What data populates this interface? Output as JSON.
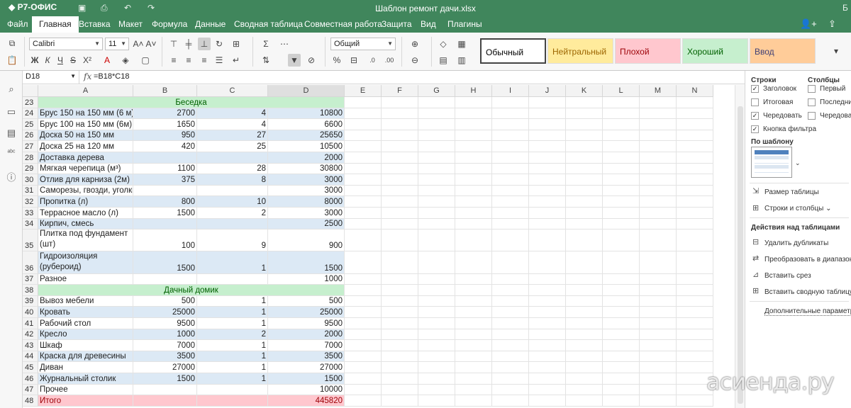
{
  "app": {
    "logo": "Р7-ОФИС",
    "doc_title": "Шаблон ремонт дачи.xlsx",
    "corner_text": "Б"
  },
  "tabs": [
    "Файл",
    "Главная",
    "Вставка",
    "Макет",
    "Формула",
    "Данные",
    "Сводная таблица",
    "Совместная работа",
    "Защита",
    "Вид",
    "Плагины"
  ],
  "toolbar": {
    "font_name": "Calibri",
    "font_size": "11",
    "number_format": "Общий",
    "styles": [
      {
        "label": "Обычный",
        "bg": "#ffffff",
        "color": "#000000"
      },
      {
        "label": "Нейтральный",
        "bg": "#ffeb9c",
        "color": "#9c6500"
      },
      {
        "label": "Плохой",
        "bg": "#ffc7ce",
        "color": "#9c0006"
      },
      {
        "label": "Хороший",
        "bg": "#c6efce",
        "color": "#006100"
      },
      {
        "label": "Ввод",
        "bg": "#ffcc99",
        "color": "#3f3f76"
      }
    ]
  },
  "formula_bar": {
    "cell_ref": "D18",
    "fx": "fx",
    "formula": "=B18*C18"
  },
  "columns": [
    "A",
    "B",
    "C",
    "D",
    "E",
    "F",
    "G",
    "H",
    "I",
    "J",
    "K",
    "L",
    "M",
    "N"
  ],
  "rows": [
    {
      "n": "23",
      "type": "section",
      "a": "Беседка"
    },
    {
      "n": "24",
      "a": "Брус 150 на 150 мм (6 м)",
      "b": "2700",
      "c": "4",
      "d": "10800"
    },
    {
      "n": "25",
      "a": "Брус 100 на 150 мм (6м)",
      "b": "1650",
      "c": "4",
      "d": "6600"
    },
    {
      "n": "26",
      "a": "Доска 50 на 150 мм",
      "b": "950",
      "c": "27",
      "d": "25650"
    },
    {
      "n": "27",
      "a": "Доска 25 на 120 мм",
      "b": "420",
      "c": "25",
      "d": "10500"
    },
    {
      "n": "28",
      "a": "Доставка дерева",
      "b": "",
      "c": "",
      "d": "2000"
    },
    {
      "n": "29",
      "a": "Мягкая черепица (м³)",
      "b": "1100",
      "c": "28",
      "d": "30800"
    },
    {
      "n": "30",
      "a": "Отлив для карниза (2м)",
      "b": "375",
      "c": "8",
      "d": "3000"
    },
    {
      "n": "31",
      "a": "Саморезы, гвозди, уголки",
      "b": "",
      "c": "",
      "d": "3000"
    },
    {
      "n": "32",
      "a": "Пропитка (л)",
      "b": "800",
      "c": "10",
      "d": "8000"
    },
    {
      "n": "33",
      "a": "Террасное масло (л)",
      "b": "1500",
      "c": "2",
      "d": "3000"
    },
    {
      "n": "34",
      "a": "Кирпич, смесь",
      "b": "",
      "c": "",
      "d": "2500"
    },
    {
      "n": "35",
      "a": "Плитка под фундамент (шт)",
      "b": "100",
      "c": "9",
      "d": "900",
      "tall": true
    },
    {
      "n": "36",
      "a": "Гидроизоляция (рубероид)",
      "b": "1500",
      "c": "1",
      "d": "1500",
      "tall": true
    },
    {
      "n": "37",
      "a": "Разное",
      "b": "",
      "c": "",
      "d": "1000"
    },
    {
      "n": "38",
      "type": "section",
      "a": "Дачный домик"
    },
    {
      "n": "39",
      "a": "Вывоз мебели",
      "b": "500",
      "c": "1",
      "d": "500"
    },
    {
      "n": "40",
      "a": "Кровать",
      "b": "25000",
      "c": "1",
      "d": "25000"
    },
    {
      "n": "41",
      "a": "Рабочий стол",
      "b": "9500",
      "c": "1",
      "d": "9500"
    },
    {
      "n": "42",
      "a": "Кресло",
      "b": "1000",
      "c": "2",
      "d": "2000"
    },
    {
      "n": "43",
      "a": "Шкаф",
      "b": "7000",
      "c": "1",
      "d": "7000"
    },
    {
      "n": "44",
      "a": "Краска для древесины",
      "b": "3500",
      "c": "1",
      "d": "3500"
    },
    {
      "n": "45",
      "a": "Диван",
      "b": "27000",
      "c": "1",
      "d": "27000"
    },
    {
      "n": "46",
      "a": "Журнальный столик",
      "b": "1500",
      "c": "1",
      "d": "1500"
    },
    {
      "n": "47",
      "a": "Прочее",
      "b": "",
      "c": "",
      "d": "10000"
    },
    {
      "n": "48",
      "type": "total",
      "a": "Итого",
      "b": "",
      "c": "",
      "d": "445820"
    }
  ],
  "colors": {
    "band": "#dce9f5",
    "section": "#c6efce",
    "section_text": "#006100",
    "total": "#ffc7ce",
    "total_text": "#9c0006",
    "brand": "#40865c"
  },
  "right_panel": {
    "rows_title": "Строки",
    "cols_title": "Столбцы",
    "row_opts": [
      {
        "label": "Заголовок",
        "checked": true
      },
      {
        "label": "Итоговая",
        "checked": false
      },
      {
        "label": "Чередовать",
        "checked": true
      },
      {
        "label": "Кнопка фильтра",
        "checked": true
      }
    ],
    "col_opts": [
      {
        "label": "Первый",
        "checked": false
      },
      {
        "label": "Последний",
        "checked": false
      },
      {
        "label": "Чередовать",
        "checked": false
      }
    ],
    "template_title": "По шаблону",
    "resize": "Размер таблицы",
    "rows_cols": "Строки и столбцы",
    "actions_title": "Действия над таблицами",
    "actions": [
      "Удалить дубликаты",
      "Преобразовать в диапазон",
      "Вставить срез",
      "Вставить сводную таблицу"
    ],
    "advanced": "Дополнительные параметры"
  },
  "watermark": "асиенда.ру"
}
